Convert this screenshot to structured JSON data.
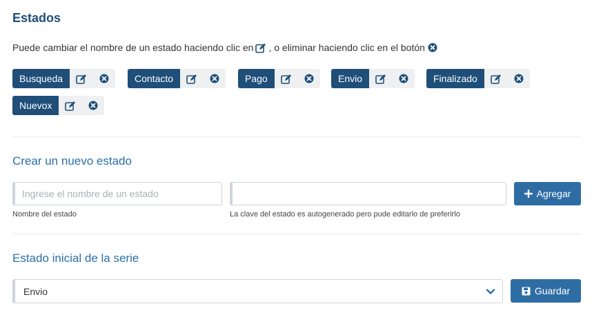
{
  "header": {
    "title": "Estados"
  },
  "intro": {
    "text_before": "Puede cambiar el nombre de un estado haciendo clic en",
    "text_middle": ", o eliminar haciendo clic en el botón"
  },
  "states": [
    {
      "label": "Busqueda"
    },
    {
      "label": "Contacto"
    },
    {
      "label": "Pago"
    },
    {
      "label": "Envio"
    },
    {
      "label": "Finalizado"
    },
    {
      "label": "Nuevox"
    }
  ],
  "create": {
    "heading": "Crear un nuevo estado",
    "name_placeholder": "Ingrese el nombre de un estado",
    "name_value": "",
    "name_help": "Nombre del estado",
    "key_value": "",
    "key_help": "La clave del estado es autogenerado pero pude editarlo de preferirlo",
    "add_label": "Agregar"
  },
  "initial": {
    "heading": "Estado inicial de la serie",
    "selected": "Envio",
    "save_label": "Guardar"
  },
  "colors": {
    "brand": "#1f4e79",
    "primary_button": "#2e6da4",
    "section_heading": "#2b6fa8"
  }
}
